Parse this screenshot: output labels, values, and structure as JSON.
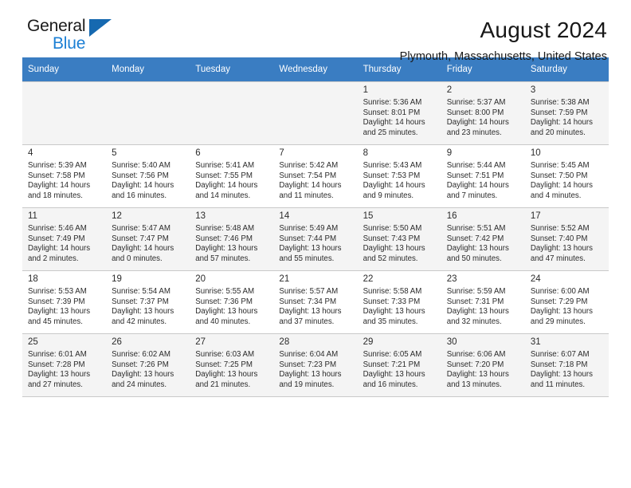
{
  "logo": {
    "text_top": "General",
    "text_bottom": "Blue",
    "icon": "triangle-icon",
    "brand_color": "#1b7fd4"
  },
  "header": {
    "title": "August 2024",
    "subtitle": "Plymouth, Massachusetts, United States"
  },
  "calendar": {
    "header_bg": "#3a7dc2",
    "weekdays": [
      "Sunday",
      "Monday",
      "Tuesday",
      "Wednesday",
      "Thursday",
      "Friday",
      "Saturday"
    ],
    "labels": {
      "sunrise": "Sunrise:",
      "sunset": "Sunset:",
      "daylight": "Daylight:"
    },
    "weeks": [
      [
        {
          "day": "",
          "empty": true
        },
        {
          "day": "",
          "empty": true
        },
        {
          "day": "",
          "empty": true
        },
        {
          "day": "",
          "empty": true
        },
        {
          "day": "1",
          "sunrise": "Sunrise: 5:36 AM",
          "sunset": "Sunset: 8:01 PM",
          "daylight1": "Daylight: 14 hours",
          "daylight2": "and 25 minutes."
        },
        {
          "day": "2",
          "sunrise": "Sunrise: 5:37 AM",
          "sunset": "Sunset: 8:00 PM",
          "daylight1": "Daylight: 14 hours",
          "daylight2": "and 23 minutes."
        },
        {
          "day": "3",
          "sunrise": "Sunrise: 5:38 AM",
          "sunset": "Sunset: 7:59 PM",
          "daylight1": "Daylight: 14 hours",
          "daylight2": "and 20 minutes."
        }
      ],
      [
        {
          "day": "4",
          "sunrise": "Sunrise: 5:39 AM",
          "sunset": "Sunset: 7:58 PM",
          "daylight1": "Daylight: 14 hours",
          "daylight2": "and 18 minutes."
        },
        {
          "day": "5",
          "sunrise": "Sunrise: 5:40 AM",
          "sunset": "Sunset: 7:56 PM",
          "daylight1": "Daylight: 14 hours",
          "daylight2": "and 16 minutes."
        },
        {
          "day": "6",
          "sunrise": "Sunrise: 5:41 AM",
          "sunset": "Sunset: 7:55 PM",
          "daylight1": "Daylight: 14 hours",
          "daylight2": "and 14 minutes."
        },
        {
          "day": "7",
          "sunrise": "Sunrise: 5:42 AM",
          "sunset": "Sunset: 7:54 PM",
          "daylight1": "Daylight: 14 hours",
          "daylight2": "and 11 minutes."
        },
        {
          "day": "8",
          "sunrise": "Sunrise: 5:43 AM",
          "sunset": "Sunset: 7:53 PM",
          "daylight1": "Daylight: 14 hours",
          "daylight2": "and 9 minutes."
        },
        {
          "day": "9",
          "sunrise": "Sunrise: 5:44 AM",
          "sunset": "Sunset: 7:51 PM",
          "daylight1": "Daylight: 14 hours",
          "daylight2": "and 7 minutes."
        },
        {
          "day": "10",
          "sunrise": "Sunrise: 5:45 AM",
          "sunset": "Sunset: 7:50 PM",
          "daylight1": "Daylight: 14 hours",
          "daylight2": "and 4 minutes."
        }
      ],
      [
        {
          "day": "11",
          "sunrise": "Sunrise: 5:46 AM",
          "sunset": "Sunset: 7:49 PM",
          "daylight1": "Daylight: 14 hours",
          "daylight2": "and 2 minutes."
        },
        {
          "day": "12",
          "sunrise": "Sunrise: 5:47 AM",
          "sunset": "Sunset: 7:47 PM",
          "daylight1": "Daylight: 14 hours",
          "daylight2": "and 0 minutes."
        },
        {
          "day": "13",
          "sunrise": "Sunrise: 5:48 AM",
          "sunset": "Sunset: 7:46 PM",
          "daylight1": "Daylight: 13 hours",
          "daylight2": "and 57 minutes."
        },
        {
          "day": "14",
          "sunrise": "Sunrise: 5:49 AM",
          "sunset": "Sunset: 7:44 PM",
          "daylight1": "Daylight: 13 hours",
          "daylight2": "and 55 minutes."
        },
        {
          "day": "15",
          "sunrise": "Sunrise: 5:50 AM",
          "sunset": "Sunset: 7:43 PM",
          "daylight1": "Daylight: 13 hours",
          "daylight2": "and 52 minutes."
        },
        {
          "day": "16",
          "sunrise": "Sunrise: 5:51 AM",
          "sunset": "Sunset: 7:42 PM",
          "daylight1": "Daylight: 13 hours",
          "daylight2": "and 50 minutes."
        },
        {
          "day": "17",
          "sunrise": "Sunrise: 5:52 AM",
          "sunset": "Sunset: 7:40 PM",
          "daylight1": "Daylight: 13 hours",
          "daylight2": "and 47 minutes."
        }
      ],
      [
        {
          "day": "18",
          "sunrise": "Sunrise: 5:53 AM",
          "sunset": "Sunset: 7:39 PM",
          "daylight1": "Daylight: 13 hours",
          "daylight2": "and 45 minutes."
        },
        {
          "day": "19",
          "sunrise": "Sunrise: 5:54 AM",
          "sunset": "Sunset: 7:37 PM",
          "daylight1": "Daylight: 13 hours",
          "daylight2": "and 42 minutes."
        },
        {
          "day": "20",
          "sunrise": "Sunrise: 5:55 AM",
          "sunset": "Sunset: 7:36 PM",
          "daylight1": "Daylight: 13 hours",
          "daylight2": "and 40 minutes."
        },
        {
          "day": "21",
          "sunrise": "Sunrise: 5:57 AM",
          "sunset": "Sunset: 7:34 PM",
          "daylight1": "Daylight: 13 hours",
          "daylight2": "and 37 minutes."
        },
        {
          "day": "22",
          "sunrise": "Sunrise: 5:58 AM",
          "sunset": "Sunset: 7:33 PM",
          "daylight1": "Daylight: 13 hours",
          "daylight2": "and 35 minutes."
        },
        {
          "day": "23",
          "sunrise": "Sunrise: 5:59 AM",
          "sunset": "Sunset: 7:31 PM",
          "daylight1": "Daylight: 13 hours",
          "daylight2": "and 32 minutes."
        },
        {
          "day": "24",
          "sunrise": "Sunrise: 6:00 AM",
          "sunset": "Sunset: 7:29 PM",
          "daylight1": "Daylight: 13 hours",
          "daylight2": "and 29 minutes."
        }
      ],
      [
        {
          "day": "25",
          "sunrise": "Sunrise: 6:01 AM",
          "sunset": "Sunset: 7:28 PM",
          "daylight1": "Daylight: 13 hours",
          "daylight2": "and 27 minutes."
        },
        {
          "day": "26",
          "sunrise": "Sunrise: 6:02 AM",
          "sunset": "Sunset: 7:26 PM",
          "daylight1": "Daylight: 13 hours",
          "daylight2": "and 24 minutes."
        },
        {
          "day": "27",
          "sunrise": "Sunrise: 6:03 AM",
          "sunset": "Sunset: 7:25 PM",
          "daylight1": "Daylight: 13 hours",
          "daylight2": "and 21 minutes."
        },
        {
          "day": "28",
          "sunrise": "Sunrise: 6:04 AM",
          "sunset": "Sunset: 7:23 PM",
          "daylight1": "Daylight: 13 hours",
          "daylight2": "and 19 minutes."
        },
        {
          "day": "29",
          "sunrise": "Sunrise: 6:05 AM",
          "sunset": "Sunset: 7:21 PM",
          "daylight1": "Daylight: 13 hours",
          "daylight2": "and 16 minutes."
        },
        {
          "day": "30",
          "sunrise": "Sunrise: 6:06 AM",
          "sunset": "Sunset: 7:20 PM",
          "daylight1": "Daylight: 13 hours",
          "daylight2": "and 13 minutes."
        },
        {
          "day": "31",
          "sunrise": "Sunrise: 6:07 AM",
          "sunset": "Sunset: 7:18 PM",
          "daylight1": "Daylight: 13 hours",
          "daylight2": "and 11 minutes."
        }
      ]
    ]
  }
}
